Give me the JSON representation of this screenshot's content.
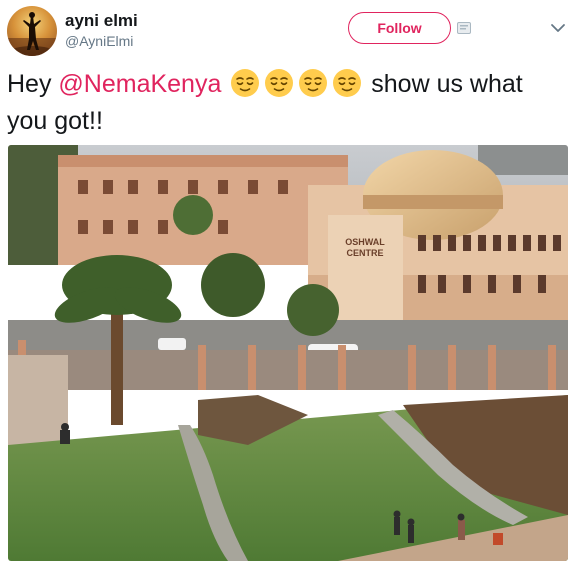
{
  "author": {
    "display_name": "ayni elmi",
    "handle": "@AyniElmi",
    "avatar_icon": "avatar-image"
  },
  "header": {
    "follow_label": "Follow",
    "accent_color": "#e0245e"
  },
  "tweet": {
    "text_before": "Hey ",
    "mention": "@NemaKenya",
    "emoji_name": "relieved-face-emoji",
    "emoji_count": 4,
    "text_after": " show us what you got!!"
  },
  "photo": {
    "sign_text_line1": "OSHWAL",
    "sign_text_line2": "CENTRE"
  }
}
